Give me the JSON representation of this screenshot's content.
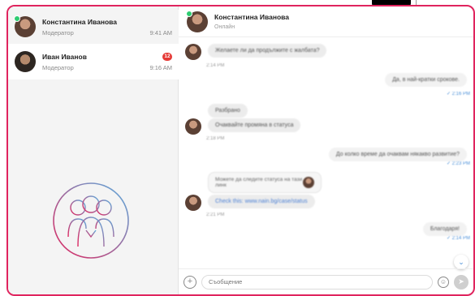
{
  "contacts": [
    {
      "name": "Константина Иванова",
      "role": "Модератор",
      "time": "9:41 AM",
      "online": true
    },
    {
      "name": "Иван Иванов",
      "role": "Модератор",
      "time": "9:16 AM",
      "unread": "12"
    }
  ],
  "chat": {
    "name": "Константина Иванова",
    "status": "Онлайн"
  },
  "messages": [
    {
      "text": "Желаете ли да продължите с жалбата?",
      "time": "2:14 PM",
      "side": "left"
    },
    {
      "text": "Да, в най-кратки срокове.",
      "time": "2:16 PM",
      "side": "right"
    },
    {
      "text": "Разбрано",
      "side": "left"
    },
    {
      "text": "Очаквайте промяна в статуса",
      "time": "2:18 PM",
      "side": "left"
    },
    {
      "text": "До колко време да очаквам някакво развитие?",
      "time": "2:23 PM",
      "side": "right"
    },
    {
      "quote": "Можете да следите статуса на тази линк",
      "text": "Check this: www.nain.bg/case/status",
      "time": "2:21 PM",
      "side": "left"
    },
    {
      "text": "Благодаря!",
      "time": "2:14 PM",
      "side": "right"
    }
  ],
  "composer": {
    "placeholder": "Съобщение"
  },
  "icons": {
    "plus": "plus-circle-icon",
    "emoji": "emoji-icon",
    "send": "send-icon",
    "scroll": "chevron-down-icon"
  },
  "colors": {
    "accent": "#4a8fd8",
    "badge": "#e53935",
    "frame": "#e0245e",
    "online": "#2ecc71"
  }
}
